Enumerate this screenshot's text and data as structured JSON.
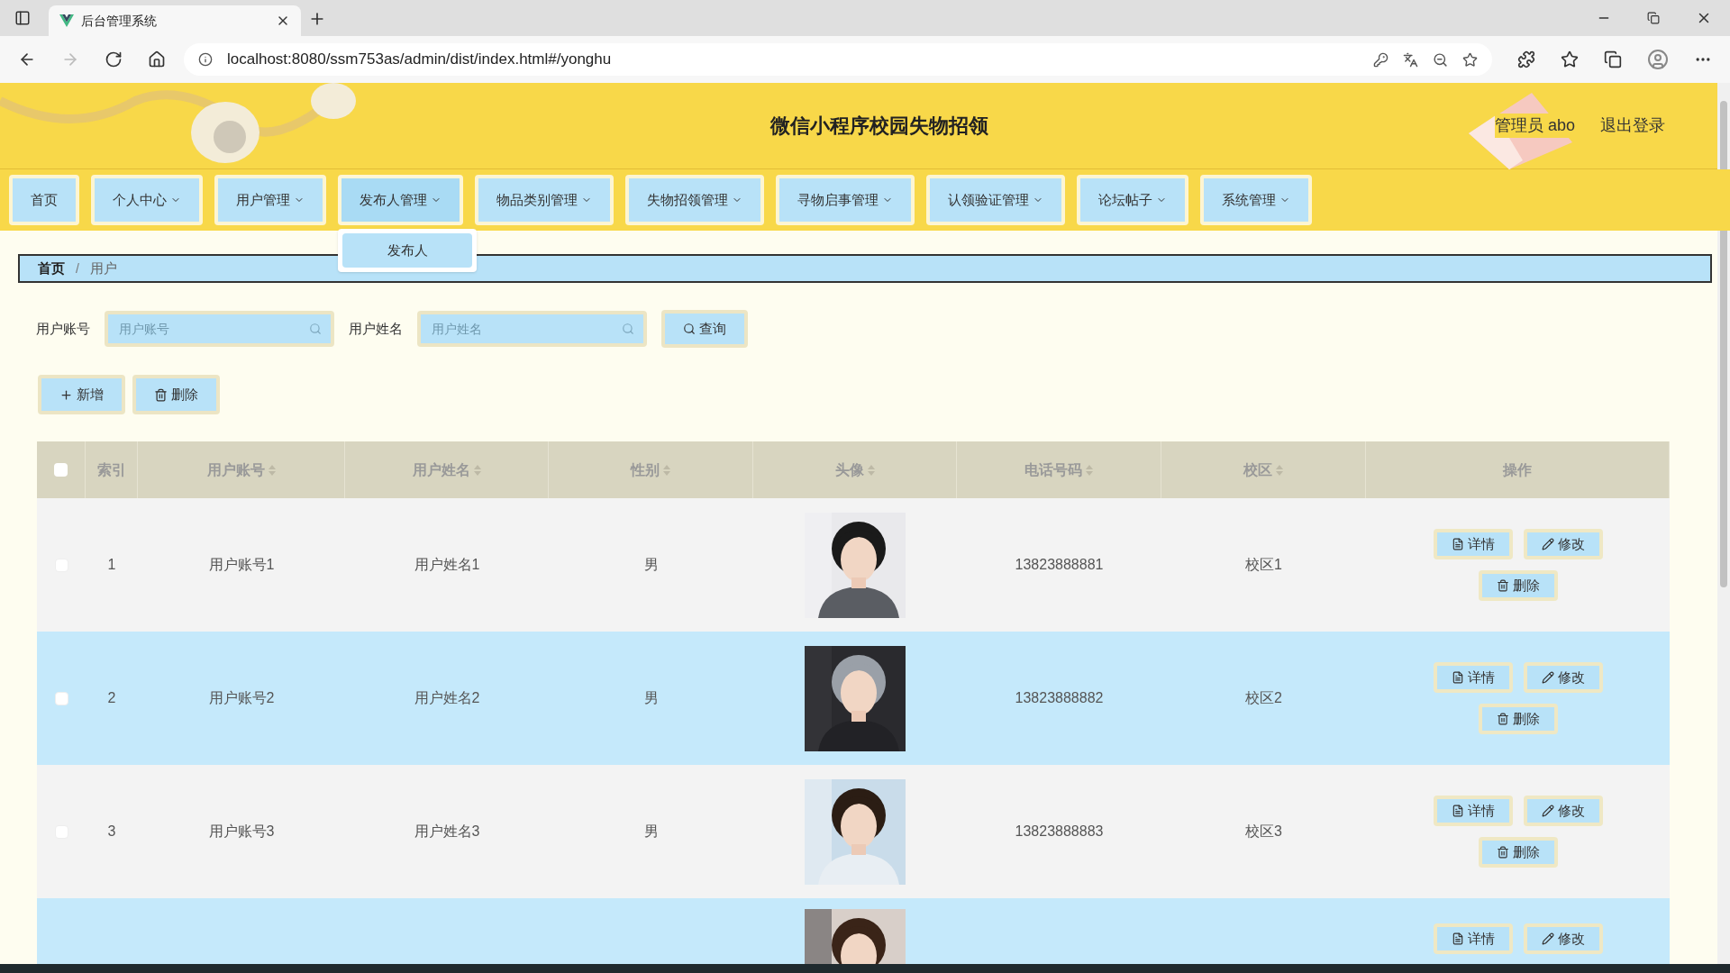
{
  "browser": {
    "tab_title": "后台管理系统",
    "url": "localhost:8080/ssm753as/admin/dist/index.html#/yonghu"
  },
  "header": {
    "title": "微信小程序校园失物招领",
    "user": "管理员 abo",
    "logout": "退出登录"
  },
  "nav": [
    {
      "label": "首页",
      "has_menu": false,
      "expanded": false
    },
    {
      "label": "个人中心",
      "has_menu": true,
      "expanded": false
    },
    {
      "label": "用户管理",
      "has_menu": true,
      "expanded": false
    },
    {
      "label": "发布人管理",
      "has_menu": true,
      "expanded": true,
      "menu": [
        "发布人"
      ]
    },
    {
      "label": "物品类别管理",
      "has_menu": true,
      "expanded": false
    },
    {
      "label": "失物招领管理",
      "has_menu": true,
      "expanded": false
    },
    {
      "label": "寻物启事管理",
      "has_menu": true,
      "expanded": false
    },
    {
      "label": "认领验证管理",
      "has_menu": true,
      "expanded": false
    },
    {
      "label": "论坛帖子",
      "has_menu": true,
      "expanded": false
    },
    {
      "label": "系统管理",
      "has_menu": true,
      "expanded": false
    }
  ],
  "breadcrumb": [
    "首页",
    "用户"
  ],
  "breadcrumb_separator": "/",
  "search": {
    "fields": [
      {
        "label": "用户账号",
        "placeholder": "用户账号"
      },
      {
        "label": "用户姓名",
        "placeholder": "用户姓名"
      }
    ],
    "button": "查询"
  },
  "actions": [
    {
      "kind": "add",
      "label": "新增"
    },
    {
      "kind": "delete",
      "label": "删除"
    }
  ],
  "table": {
    "select_all": {
      "checked": false
    },
    "columns": [
      {
        "label": "索引",
        "sortable": false
      },
      {
        "label": "用户账号",
        "sortable": true
      },
      {
        "label": "用户姓名",
        "sortable": true
      },
      {
        "label": "性别",
        "sortable": true
      },
      {
        "label": "头像",
        "sortable": true
      },
      {
        "label": "电话号码",
        "sortable": true
      },
      {
        "label": "校区",
        "sortable": true
      },
      {
        "label": "操作",
        "sortable": false
      }
    ],
    "rows": [
      {
        "checked": false,
        "highlighted": false,
        "index": "1",
        "account": "用户账号1",
        "name": "用户姓名1",
        "gender": "男",
        "avatar": {
          "kind": "picture"
        },
        "phone": "13823888881",
        "campus": "校区1",
        "buttons": [
          {
            "kind": "detail",
            "label": "详情"
          },
          {
            "kind": "edit",
            "label": "修改"
          },
          {
            "kind": "delete",
            "label": "删除"
          }
        ]
      },
      {
        "checked": false,
        "highlighted": true,
        "index": "2",
        "account": "用户账号2",
        "name": "用户姓名2",
        "gender": "男",
        "avatar": {
          "kind": "picture"
        },
        "phone": "13823888882",
        "campus": "校区2",
        "buttons": [
          {
            "kind": "detail",
            "label": "详情"
          },
          {
            "kind": "edit",
            "label": "修改"
          },
          {
            "kind": "delete",
            "label": "删除"
          }
        ]
      },
      {
        "checked": false,
        "highlighted": false,
        "index": "3",
        "account": "用户账号3",
        "name": "用户姓名3",
        "gender": "男",
        "avatar": {
          "kind": "picture"
        },
        "phone": "13823888883",
        "campus": "校区3",
        "buttons": [
          {
            "kind": "detail",
            "label": "详情"
          },
          {
            "kind": "edit",
            "label": "修改"
          },
          {
            "kind": "delete",
            "label": "删除"
          }
        ]
      },
      {
        "highlighted": true,
        "avatar": {
          "kind": "picture"
        },
        "buttons": [
          {
            "kind": "detail",
            "label": "详情"
          },
          {
            "kind": "edit",
            "label": "修改"
          }
        ]
      }
    ]
  }
}
